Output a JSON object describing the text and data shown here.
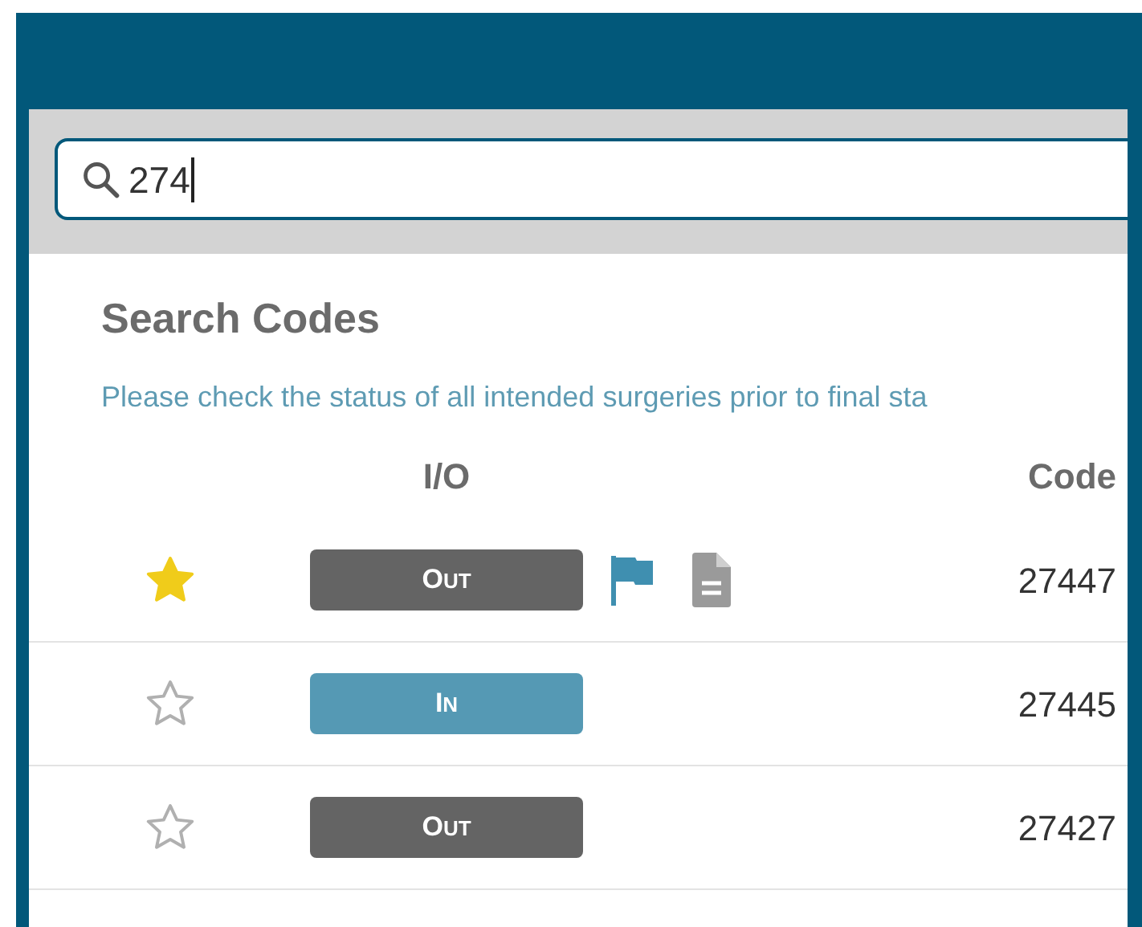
{
  "search": {
    "value": "274"
  },
  "title": "Search Codes",
  "notice": "Please check the status of all intended surgeries prior to final sta",
  "table": {
    "columns": [
      "I/O",
      "Code"
    ],
    "rows": [
      {
        "starred": true,
        "io": "OUT",
        "kind": "out",
        "flagged": true,
        "has_note": true,
        "code": "27447"
      },
      {
        "starred": false,
        "io": "IN",
        "kind": "in",
        "flagged": false,
        "has_note": false,
        "code": "27445"
      },
      {
        "starred": false,
        "io": "OUT",
        "kind": "out",
        "flagged": false,
        "has_note": false,
        "code": "27427"
      }
    ]
  }
}
